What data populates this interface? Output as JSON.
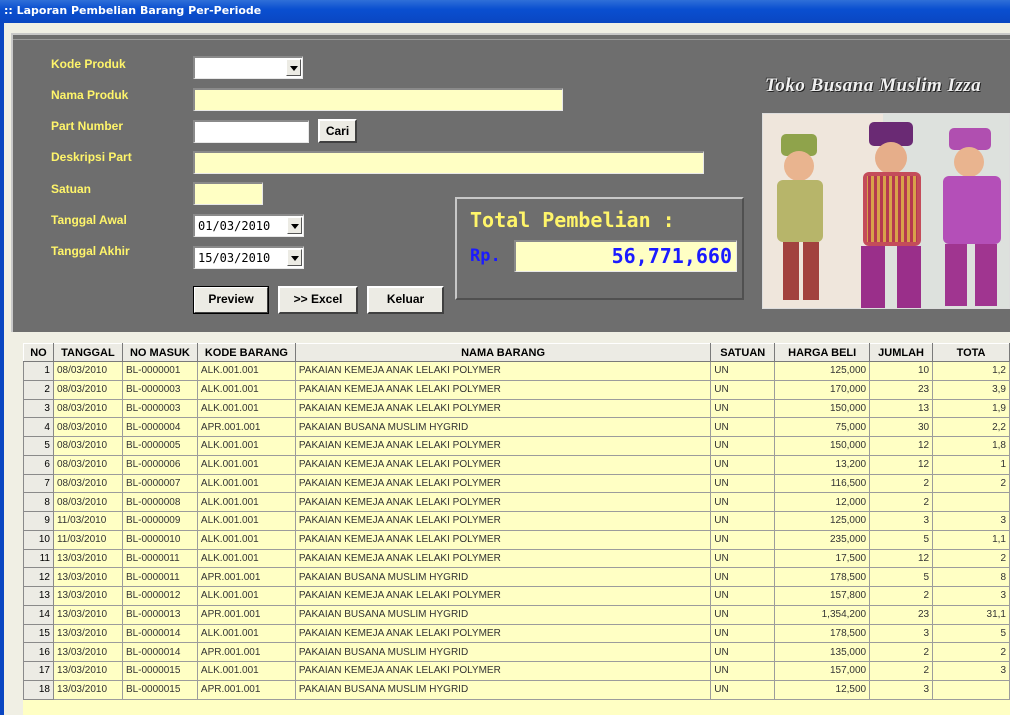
{
  "window": {
    "title": ":: Laporan Pembelian Barang Per-Periode"
  },
  "form": {
    "kode_produk_label": "Kode Produk",
    "nama_produk_label": "Nama Produk",
    "part_number_label": "Part Number",
    "deskripsi_part_label": "Deskripsi Part",
    "satuan_label": "Satuan",
    "tanggal_awal_label": "Tanggal Awal",
    "tanggal_akhir_label": "Tanggal Akhir",
    "kode_produk_value": "",
    "nama_produk_value": "",
    "part_number_value": "",
    "deskripsi_part_value": "",
    "satuan_value": "",
    "tanggal_awal_value": "01/03/2010",
    "tanggal_akhir_value": "15/03/2010",
    "cari_label": "Cari"
  },
  "buttons": {
    "preview": "Preview",
    "excel": ">> Excel",
    "keluar": "Keluar"
  },
  "total": {
    "title": "Total Pembelian :",
    "currency": "Rp.",
    "value": "56,771,660"
  },
  "shop": {
    "title": "Toko Busana Muslim Izza"
  },
  "table": {
    "columns": [
      "NO",
      "TANGGAL",
      "NO MASUK",
      "KODE BARANG",
      "NAMA BARANG",
      "SATUAN",
      "HARGA BELI",
      "JUMLAH",
      "TOTA"
    ],
    "rows": [
      [
        "1",
        "08/03/2010",
        "BL-0000001",
        "ALK.001.001",
        "PAKAIAN KEMEJA ANAK LELAKI POLYMER",
        "UN",
        "125,000",
        "10",
        "1,2"
      ],
      [
        "2",
        "08/03/2010",
        "BL-0000003",
        "ALK.001.001",
        "PAKAIAN KEMEJA ANAK LELAKI POLYMER",
        "UN",
        "170,000",
        "23",
        "3,9"
      ],
      [
        "3",
        "08/03/2010",
        "BL-0000003",
        "ALK.001.001",
        "PAKAIAN KEMEJA ANAK LELAKI POLYMER",
        "UN",
        "150,000",
        "13",
        "1,9"
      ],
      [
        "4",
        "08/03/2010",
        "BL-0000004",
        "APR.001.001",
        "PAKAIAN BUSANA MUSLIM HYGRID",
        "UN",
        "75,000",
        "30",
        "2,2"
      ],
      [
        "5",
        "08/03/2010",
        "BL-0000005",
        "ALK.001.001",
        "PAKAIAN KEMEJA ANAK LELAKI POLYMER",
        "UN",
        "150,000",
        "12",
        "1,8"
      ],
      [
        "6",
        "08/03/2010",
        "BL-0000006",
        "ALK.001.001",
        "PAKAIAN KEMEJA ANAK LELAKI POLYMER",
        "UN",
        "13,200",
        "12",
        "1"
      ],
      [
        "7",
        "08/03/2010",
        "BL-0000007",
        "ALK.001.001",
        "PAKAIAN KEMEJA ANAK LELAKI POLYMER",
        "UN",
        "116,500",
        "2",
        "2"
      ],
      [
        "8",
        "08/03/2010",
        "BL-0000008",
        "ALK.001.001",
        "PAKAIAN KEMEJA ANAK LELAKI POLYMER",
        "UN",
        "12,000",
        "2",
        ""
      ],
      [
        "9",
        "11/03/2010",
        "BL-0000009",
        "ALK.001.001",
        "PAKAIAN KEMEJA ANAK LELAKI POLYMER",
        "UN",
        "125,000",
        "3",
        "3"
      ],
      [
        "10",
        "11/03/2010",
        "BL-0000010",
        "ALK.001.001",
        "PAKAIAN KEMEJA ANAK LELAKI POLYMER",
        "UN",
        "235,000",
        "5",
        "1,1"
      ],
      [
        "11",
        "13/03/2010",
        "BL-0000011",
        "ALK.001.001",
        "PAKAIAN KEMEJA ANAK LELAKI POLYMER",
        "UN",
        "17,500",
        "12",
        "2"
      ],
      [
        "12",
        "13/03/2010",
        "BL-0000011",
        "APR.001.001",
        "PAKAIAN BUSANA MUSLIM HYGRID",
        "UN",
        "178,500",
        "5",
        "8"
      ],
      [
        "13",
        "13/03/2010",
        "BL-0000012",
        "ALK.001.001",
        "PAKAIAN KEMEJA ANAK LELAKI POLYMER",
        "UN",
        "157,800",
        "2",
        "3"
      ],
      [
        "14",
        "13/03/2010",
        "BL-0000013",
        "APR.001.001",
        "PAKAIAN BUSANA MUSLIM HYGRID",
        "UN",
        "1,354,200",
        "23",
        "31,1"
      ],
      [
        "15",
        "13/03/2010",
        "BL-0000014",
        "ALK.001.001",
        "PAKAIAN KEMEJA ANAK LELAKI POLYMER",
        "UN",
        "178,500",
        "3",
        "5"
      ],
      [
        "16",
        "13/03/2010",
        "BL-0000014",
        "APR.001.001",
        "PAKAIAN BUSANA MUSLIM HYGRID",
        "UN",
        "135,000",
        "2",
        "2"
      ],
      [
        "17",
        "13/03/2010",
        "BL-0000015",
        "ALK.001.001",
        "PAKAIAN KEMEJA ANAK LELAKI POLYMER",
        "UN",
        "157,000",
        "2",
        "3"
      ],
      [
        "18",
        "13/03/2010",
        "BL-0000015",
        "APR.001.001",
        "PAKAIAN BUSANA MUSLIM HYGRID",
        "UN",
        "12,500",
        "3",
        ""
      ]
    ]
  }
}
